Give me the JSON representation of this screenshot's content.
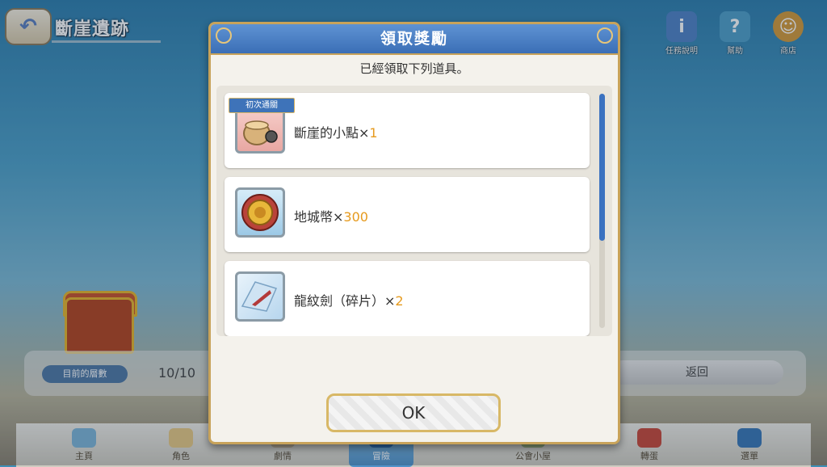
{
  "header": {
    "back_icon": "back-arrow-icon",
    "stage_title": "斷崖遺跡"
  },
  "top_icons": [
    {
      "name": "info",
      "label": "任務說明",
      "icon": "info-icon",
      "color": "#4f83c7"
    },
    {
      "name": "help",
      "label": "幫助",
      "icon": "question-icon",
      "color": "#4fa0c9"
    },
    {
      "name": "shop",
      "label": "商店",
      "icon": "merchant-icon",
      "color": "#d49a3a"
    }
  ],
  "mid_bar": {
    "count_label": "目前的層數",
    "count_value": "10/10",
    "return_label": "返回"
  },
  "bottom_nav": [
    {
      "name": "home",
      "label": "主頁"
    },
    {
      "name": "character",
      "label": "角色"
    },
    {
      "name": "story",
      "label": "劇情"
    },
    {
      "name": "adventure",
      "label": "冒險"
    },
    {
      "name": "guild",
      "label": "公會小屋"
    },
    {
      "name": "gacha",
      "label": "轉蛋"
    },
    {
      "name": "menu",
      "label": "選單"
    }
  ],
  "modal": {
    "title": "領取獎勵",
    "subtitle": "已經領取下列道具。",
    "items": [
      {
        "name": "斷崖的小點",
        "qty": "1",
        "badge": "初次通關",
        "icon": "food-tray-icon"
      },
      {
        "name": "地城幣",
        "qty": "300",
        "badge": "",
        "icon": "dungeon-coin-icon"
      },
      {
        "name": "龍紋劍（碎片）",
        "qty": "2",
        "badge": "",
        "icon": "dragon-sword-shard-icon"
      }
    ],
    "times": "×",
    "ok_label": "OK"
  },
  "colors": {
    "accent_blue": "#3b6fb6",
    "qty_orange": "#e69a1d",
    "gold_border": "#c8a35a"
  }
}
